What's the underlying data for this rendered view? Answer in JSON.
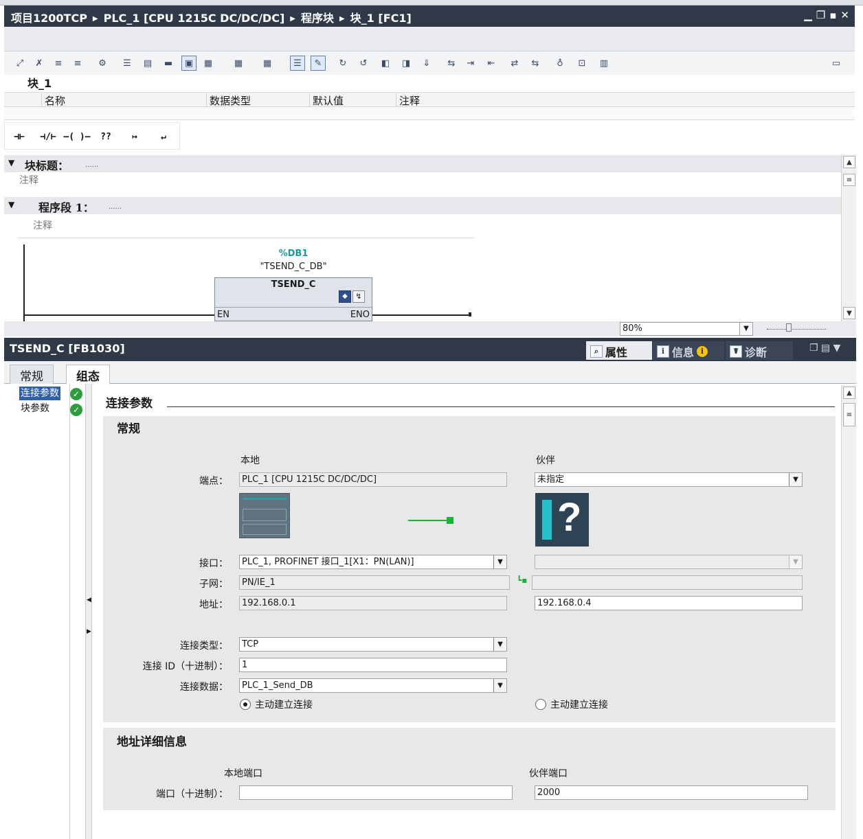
{
  "title_bar": {
    "crumbs": [
      "项目1200TCP",
      "PLC_1 [CPU 1215C DC/DC/DC]",
      "程序块",
      "块_1 [FC1]"
    ],
    "window_buttons": [
      "▁",
      "❐",
      "▪",
      "✕"
    ]
  },
  "editor": {
    "block_name": "块_1",
    "interface_columns": [
      "名称",
      "数据类型",
      "默认值",
      "注释"
    ],
    "ladder_elements": [
      "⊣⊢",
      "⊣/⊢",
      "–( )–",
      "??",
      "↦",
      "↵"
    ],
    "block_title_label": "块标题：",
    "block_title_dots": "......",
    "block_comment": "注释",
    "network_label": "程序段 1：",
    "network_dots": "......",
    "network_comment": "注释",
    "instance_db": "%DB1",
    "instance_db_name": "\"TSEND_C_DB\"",
    "function_block": "TSEND_C",
    "pin_en": "EN",
    "pin_eno": "ENO",
    "zoom": "80%"
  },
  "inspector": {
    "title": "TSEND_C [FB1030]",
    "tabs": [
      {
        "label": "属性",
        "icon": "magnifier-icon"
      },
      {
        "label": "信息",
        "icon": "info-icon"
      },
      {
        "label": "诊断",
        "icon": "stethoscope-icon"
      }
    ],
    "subtabs": [
      "常规",
      "组态"
    ],
    "nav": [
      {
        "label": "连接参数",
        "status": "ok"
      },
      {
        "label": "块参数",
        "status": "ok"
      }
    ],
    "heading": "连接参数"
  },
  "general": {
    "title": "常规",
    "local_header": "本地",
    "partner_header": "伙伴",
    "labels": {
      "endpoint": "端点：",
      "interface": "接口：",
      "subnet": "子网：",
      "address": "地址：",
      "conn_type": "连接类型：",
      "conn_id": "连接 ID（十进制）：",
      "conn_data": "连接数据："
    },
    "local": {
      "endpoint": "PLC_1 [CPU 1215C DC/DC/DC]",
      "interface": "PLC_1, PROFINET 接口_1[X1：PN(LAN)]",
      "subnet": "PN/IE_1",
      "address": "192.168.0.1"
    },
    "partner": {
      "endpoint": "未指定",
      "interface": "",
      "subnet": "",
      "address": "192.168.0.4"
    },
    "conn_type": "TCP",
    "conn_id": "1",
    "conn_data": "PLC_1_Send_DB",
    "active_local": "主动建立连接",
    "active_partner": "主动建立连接",
    "active_side": "local"
  },
  "address_details": {
    "title": "地址详细信息",
    "local_port_header": "本地端口",
    "partner_port_header": "伙伴端口",
    "port_label": "端口（十进制）：",
    "local_port": "",
    "partner_port": "2000"
  },
  "colors": {
    "titlebar": "#2f3948",
    "selection": "#2f5fa8",
    "ok_green": "#2e9d3b",
    "db_teal": "#1a9a9a",
    "link_green": "#1db13a"
  }
}
